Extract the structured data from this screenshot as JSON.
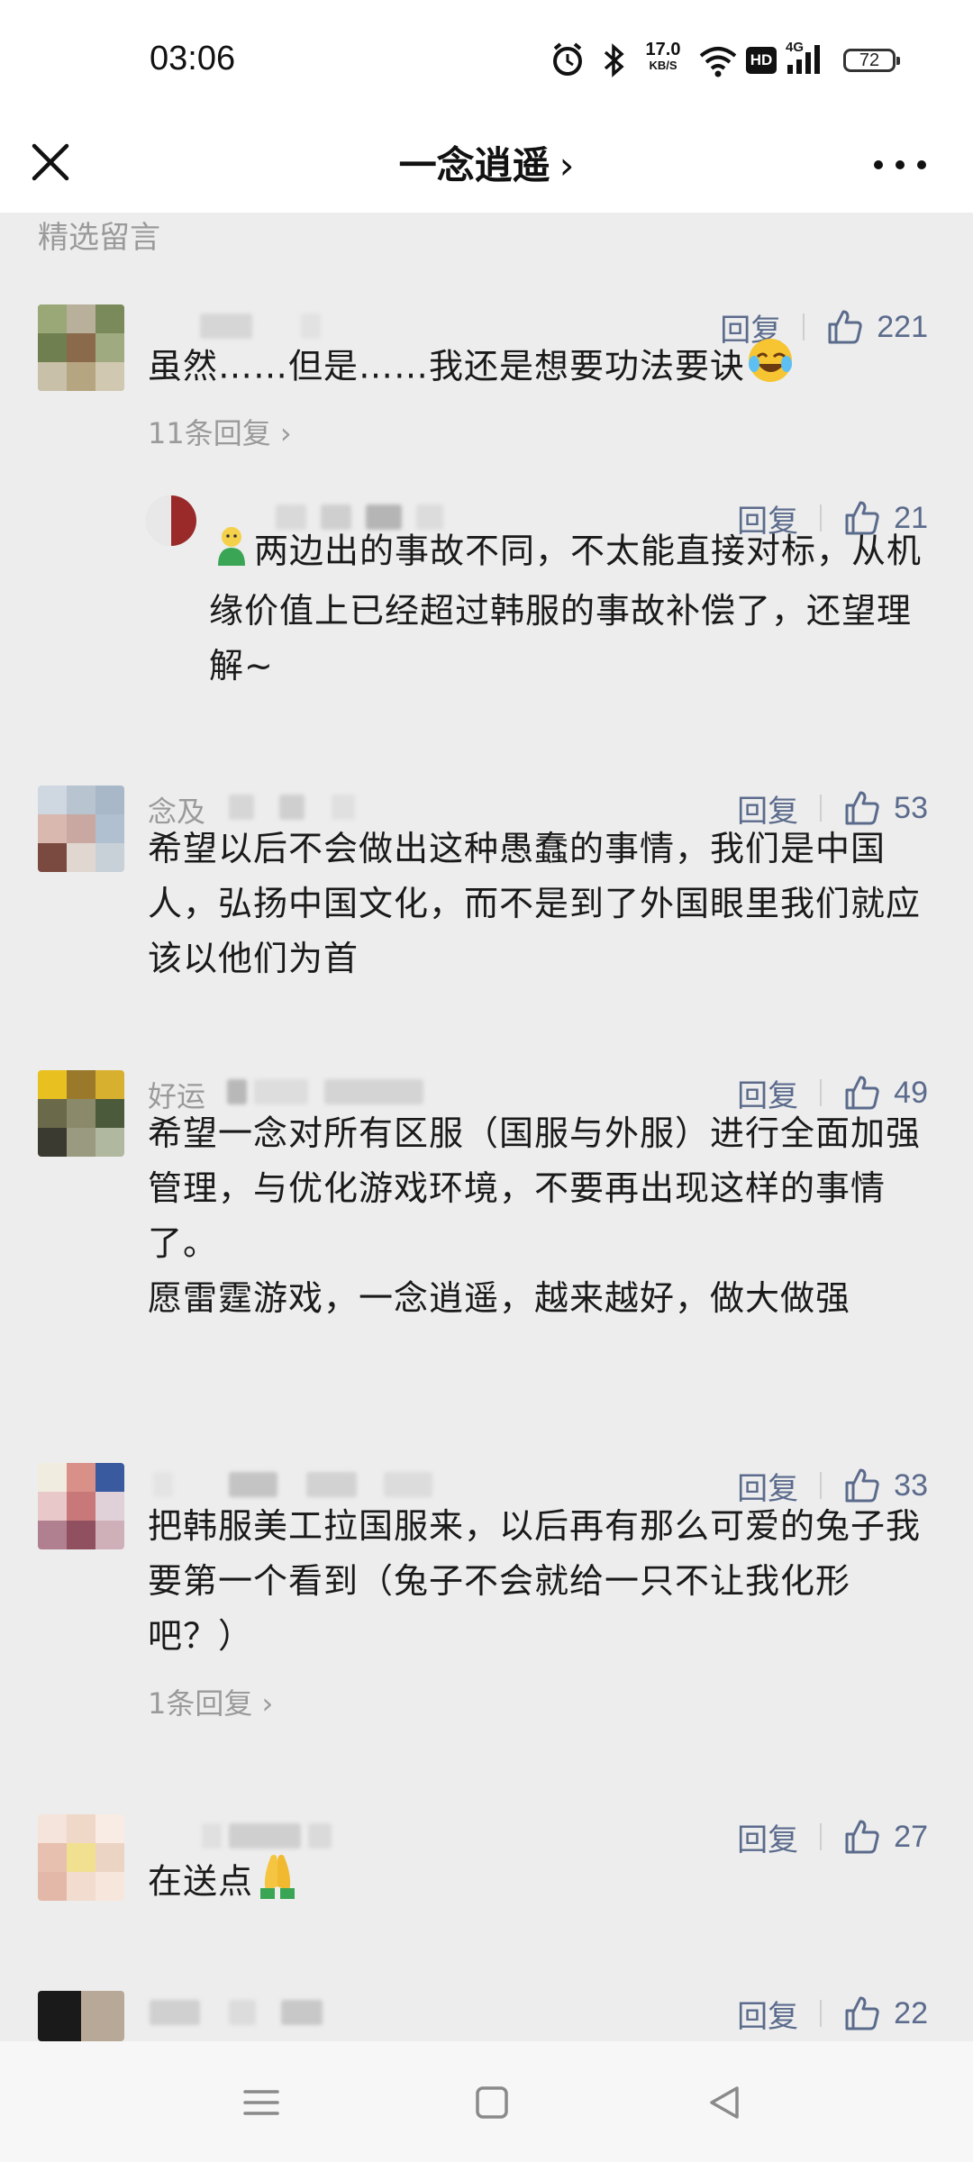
{
  "status_bar": {
    "time": "03:06",
    "net_speed_value": "17.0",
    "net_speed_unit": "KB/S",
    "network": "4G",
    "hd_badge": "HD",
    "battery": "72",
    "icons": [
      "alarm-icon",
      "bluetooth-icon",
      "wifi-icon",
      "hd-icon",
      "signal-icon",
      "battery-icon"
    ]
  },
  "nav": {
    "title": "一念逍遥",
    "title_chevron": "›",
    "icons": [
      "close-icon",
      "more-icon"
    ]
  },
  "section_label": "精选留言",
  "labels": {
    "reply": "回复"
  },
  "colors": {
    "link": "#5b6b8c",
    "muted": "#9a9a9a",
    "background": "#ededed"
  },
  "comments": [
    {
      "nickname": "",
      "likes": "221",
      "text": "虽然……但是……我还是想要功法要诀",
      "emoji": "laughing-crying-emoji",
      "replies_link": "11条回复 ›",
      "author_reply": {
        "likes": "21",
        "emoji": "green-figure-emoji",
        "text": "两边出的事故不同，不太能直接对标，从机缘价值上已经超过韩服的事故补偿了，还望理解~"
      }
    },
    {
      "nickname": "念及",
      "likes": "53",
      "text": "希望以后不会做出这种愚蠢的事情，我们是中国人，弘扬中国文化，而不是到了外国眼里我们就应该以他们为首"
    },
    {
      "nickname": "好运",
      "likes": "49",
      "text_lines": [
        "希望一念对所有区服（国服与外服）进行全面加强管理，与优化游戏环境，不要再出现这样的事情了。",
        "愿雷霆游戏，一念逍遥，越来越好，做大做强"
      ]
    },
    {
      "nickname": "",
      "likes": "33",
      "text": "把韩服美工拉国服来，以后再有那么可爱的兔子我要第一个看到（兔子不会就给一只不让我化形吧？）",
      "replies_link": "1条回复 ›"
    },
    {
      "nickname": "",
      "likes": "27",
      "text": "在送点",
      "emoji": "pray-emoji"
    },
    {
      "nickname": "",
      "likes": "22"
    }
  ],
  "system_nav": [
    "menu-icon",
    "home-icon",
    "back-icon"
  ]
}
